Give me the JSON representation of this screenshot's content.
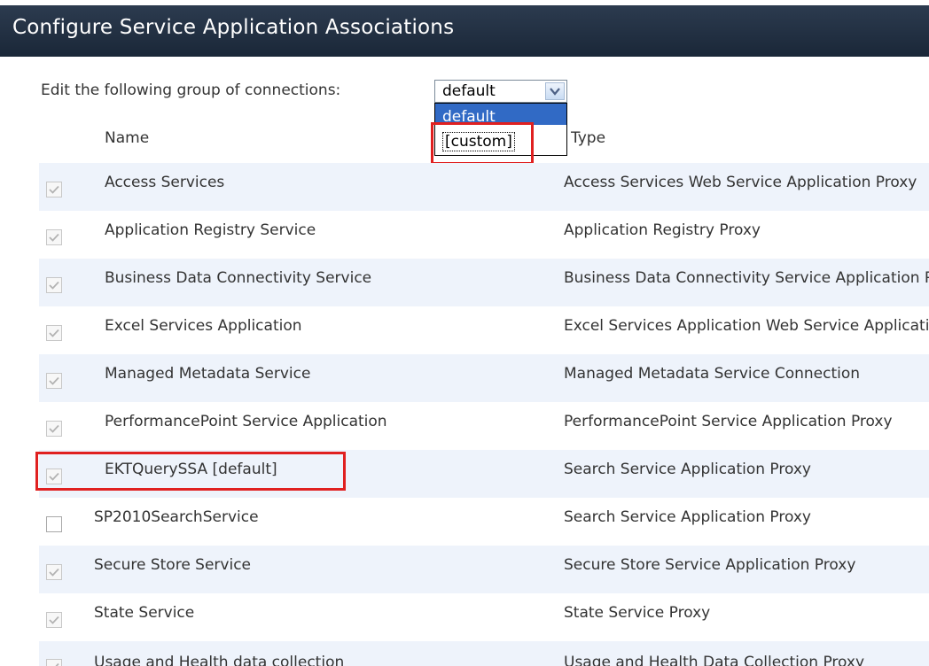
{
  "title": "Configure Service Application Associations",
  "edit_label": "Edit the following group of connections:",
  "group_select": {
    "selected": "default",
    "options": [
      "default",
      "[custom]"
    ],
    "highlighted": "default"
  },
  "columns": {
    "name": "Name",
    "type": "Type"
  },
  "rows": [
    {
      "name": "Access Services",
      "type": "Access Services Web Service Application Proxy",
      "checked": true
    },
    {
      "name": "Application Registry Service",
      "type": "Application Registry Proxy",
      "checked": true
    },
    {
      "name": "Business Data Connectivity Service",
      "type": "Business Data Connectivity Service Application Proxy",
      "checked": true
    },
    {
      "name": "Excel Services Application",
      "type": "Excel Services Application Web Service Application Proxy",
      "checked": true
    },
    {
      "name": "Managed Metadata Service",
      "type": "Managed Metadata Service Connection",
      "checked": true
    },
    {
      "name": "PerformancePoint Service Application",
      "type": "PerformancePoint Service Application Proxy",
      "checked": true
    },
    {
      "name": "EKTQuerySSA [default]",
      "type": "Search Service Application Proxy",
      "checked": true
    },
    {
      "name": "SP2010SearchService",
      "type": "Search Service Application Proxy",
      "checked": false
    },
    {
      "name": "Secure Store Service",
      "type": "Secure Store Service Application Proxy",
      "checked": true
    },
    {
      "name": "State Service",
      "type": "State Service Proxy",
      "checked": true
    },
    {
      "name": "Usage and Health data collection",
      "type": "Usage and Health Data Collection Proxy",
      "checked": true
    }
  ],
  "colors": {
    "title_bg": "#1f2d40",
    "alt_row": "#eef3fb",
    "highlight": "#e02020",
    "selection": "#316ac5"
  }
}
